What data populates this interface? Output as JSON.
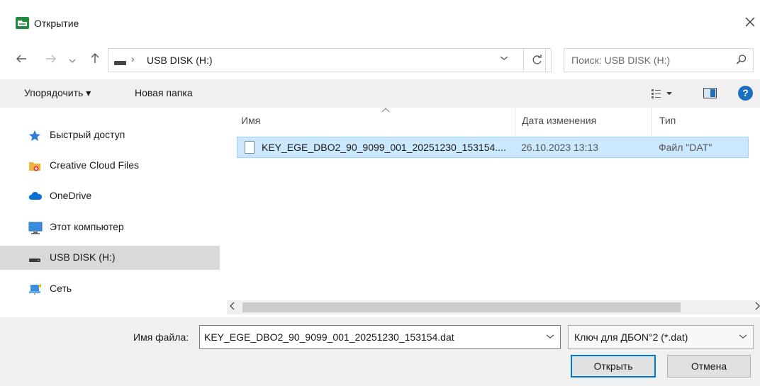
{
  "window": {
    "title": "Открытие",
    "close_glyph": "✕"
  },
  "navigation": {
    "back_icon": "arrow-left-icon",
    "forward_icon": "arrow-right-icon",
    "recent_icon": "chevron-down-icon",
    "up_icon": "arrow-up-icon"
  },
  "address": {
    "crumb": "USB DISK (H:)",
    "separator": "›"
  },
  "search": {
    "placeholder": "Поиск: USB DISK (H:)"
  },
  "toolbar": {
    "organize_label": "Упорядочить ▾",
    "new_folder_label": "Новая папка",
    "help_label": "?"
  },
  "sidebar": {
    "items": [
      {
        "label": "Быстрый доступ",
        "icon": "star-icon"
      },
      {
        "label": "Creative Cloud Files",
        "icon": "creative-cloud-folder-icon"
      },
      {
        "label": "OneDrive",
        "icon": "cloud-icon"
      },
      {
        "label": "Этот компьютер",
        "icon": "monitor-icon"
      },
      {
        "label": "USB DISK (H:)",
        "icon": "usb-drive-icon",
        "selected": true
      },
      {
        "label": "Сеть",
        "icon": "network-icon"
      }
    ]
  },
  "file_list": {
    "columns": [
      "Имя",
      "Дата изменения",
      "Тип"
    ],
    "rows": [
      {
        "name": "KEY_EGE_DBO2_90_9099_001_20251230_153154....",
        "modified": "26.10.2023 13:13",
        "type": "Файл \"DAT\""
      }
    ]
  },
  "bottom": {
    "filename_label": "Имя файла:",
    "filename_value": "KEY_EGE_DBO2_90_9099_001_20251230_153154.dat",
    "filter_value": "Ключ для ДБОN°2 (*.dat)",
    "open_label": "Открыть",
    "cancel_label": "Отмена"
  },
  "colors": {
    "selection": "#cce8ff",
    "accent": "#0078d7",
    "app_icon": "#1f8b3d"
  }
}
